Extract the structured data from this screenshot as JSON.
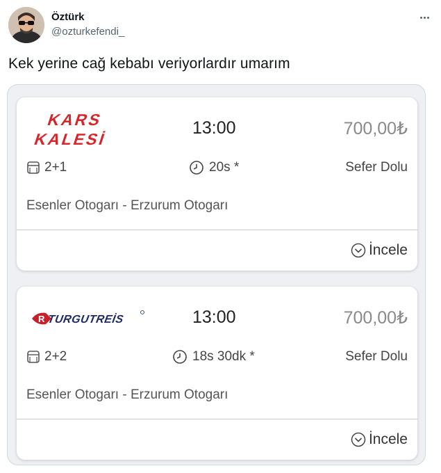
{
  "tweet": {
    "author_name": "Öztürk",
    "author_handle": "@ozturkefendi_",
    "text": "Kek yerine cağ kebabı veriyorlardır umarım"
  },
  "trips": [
    {
      "company": "KARS KALESİ",
      "logo_line1": "KARS",
      "logo_line2": "KALESİ",
      "time": "13:00",
      "price": "700,00₺",
      "seat_layout": "2+1",
      "duration": "20s *",
      "status": "Sefer Dolu",
      "route": "Esenler Otogarı - Erzurum Otogarı",
      "inspect_label": "İncele"
    },
    {
      "company": "TURGUTREİS",
      "logo_text": "TURGUTREİS",
      "logo_badge": "R",
      "time": "13:00",
      "price": "700,00₺",
      "seat_layout": "2+2",
      "duration": "18s 30dk *",
      "status": "Sefer Dolu",
      "route": "Esenler Otogarı - Erzurum Otogarı",
      "inspect_label": "İncele"
    }
  ],
  "colors": {
    "kars_logo": "#d7262a",
    "turgutreis_logo": "#c8202a",
    "price_gray": "#8a8a8a",
    "panel_bg": "#eef0f4"
  }
}
